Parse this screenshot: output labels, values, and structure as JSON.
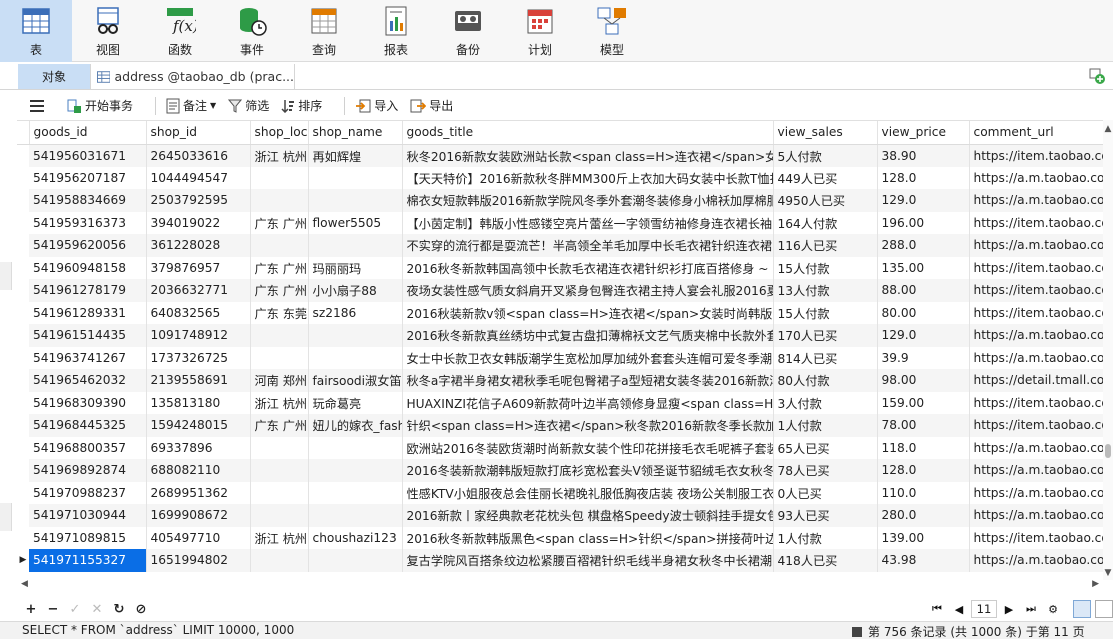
{
  "ribbon": {
    "items": [
      {
        "label": "表",
        "icon": "table-icon",
        "active": true
      },
      {
        "label": "视图",
        "icon": "view-icon",
        "active": false
      },
      {
        "label": "函数",
        "icon": "function-icon",
        "active": false
      },
      {
        "label": "事件",
        "icon": "event-icon",
        "active": false
      },
      {
        "label": "查询",
        "icon": "query-icon",
        "active": false
      },
      {
        "label": "报表",
        "icon": "report-icon",
        "active": false
      },
      {
        "label": "备份",
        "icon": "backup-icon",
        "active": false
      },
      {
        "label": "计划",
        "icon": "schedule-icon",
        "active": false
      },
      {
        "label": "模型",
        "icon": "model-icon",
        "active": false
      }
    ]
  },
  "tabs": {
    "object_label": "对象",
    "doc_label": "address @taobao_db (prac..."
  },
  "toolbar": {
    "begin_tx": "开始事务",
    "memo": "备注",
    "filter": "筛选",
    "sort": "排序",
    "import": "导入",
    "export": "导出"
  },
  "grid": {
    "columns": [
      "goods_id",
      "shop_id",
      "shop_loc",
      "shop_name",
      "goods_title",
      "view_sales",
      "view_price",
      "comment_url"
    ],
    "rows": [
      [
        "541956031671",
        "2645033616",
        "浙江 杭州",
        "再如辉煌",
        "秋冬2016新款女装欧洲站长款<span class=H>连衣裙</span>女装",
        "5人付款",
        "38.90",
        "https://item.taobao.co"
      ],
      [
        "541956207187",
        "1044494547",
        "",
        "",
        "【天天特价】2016新款秋冬胖MM300斤上衣加大码女装中长款T恤打底",
        "449人已买",
        "128.0",
        "https://a.m.taobao.co"
      ],
      [
        "541958834669",
        "2503792595",
        "",
        "",
        "棉衣女短款韩版2016新款学院风冬季外套潮冬装修身小棉袄加厚棉服",
        "4950人已买",
        "129.0",
        "https://a.m.taobao.co"
      ],
      [
        "541959316373",
        "394019022",
        "广东 广州",
        "flower5505",
        "【小茵定制】韩版小性感镂空亮片蕾丝一字领雪纺袖修身连衣裙长袖",
        "164人付款",
        "196.00",
        "https://item.taobao.co"
      ],
      [
        "541959620056",
        "361228028",
        "",
        "",
        "不实穿的流行都是耍流芒！半高领全羊毛加厚中长毛衣裙针织连衣裙",
        "116人已买",
        "288.0",
        "https://a.m.taobao.co"
      ],
      [
        "541960948158",
        "379876957",
        "广东 广州",
        "玛丽丽玛",
        "2016秋冬新款韩国高领中长款毛衣裙连衣裙针织衫打底百搭修身 ~",
        "15人付款",
        "135.00",
        "https://item.taobao.co"
      ],
      [
        "541961278179",
        "2036632771",
        "广东 广州",
        "小小扇子88",
        "夜场女装性感气质女斜肩开叉紧身包臀连衣裙主持人宴会礼服2016夏",
        "13人付款",
        "88.00",
        "https://item.taobao.co"
      ],
      [
        "541961289331",
        "640832565",
        "广东 东莞",
        "sz2186",
        "2016秋装新款v领<span class=H>连衣裙</span>女装时尚韩版<span",
        "15人付款",
        "80.00",
        "https://item.taobao.co"
      ],
      [
        "541961514435",
        "1091748912",
        "",
        "",
        "2016秋冬新款真丝绣坊中式复古盘扣薄棉袄文艺气质夹棉中长款外套",
        "170人已买",
        "129.0",
        "https://a.m.taobao.co"
      ],
      [
        "541963741267",
        "1737326725",
        "",
        "",
        "女士中长款卫衣女韩版潮学生宽松加厚加绒外套套头连帽可爱冬季潮",
        "814人已买",
        "39.9",
        "https://a.m.taobao.co"
      ],
      [
        "541965462032",
        "2139558691",
        "河南 郑州",
        "fairsoodi淑女笛",
        "秋冬a字裙半身裙女裙秋季毛呢包臀裙子a型短裙女装冬装2016新款潮",
        "80人付款",
        "98.00",
        "https://detail.tmall.co"
      ],
      [
        "541968309390",
        "135813180",
        "浙江 杭州",
        "玩命葛亮",
        "HUAXINZI花信子A609新款荷叶边半高领修身显瘦<span class=H>连",
        "3人付款",
        "159.00",
        "https://item.taobao.co"
      ],
      [
        "541968445325",
        "1594248015",
        "广东 广州",
        "妞儿的嫁衣_fash",
        "针织<span class=H>连衣裙</span>秋冬款2016新款冬季长款加厚",
        "1人付款",
        "78.00",
        "https://item.taobao.co"
      ],
      [
        "541968800357",
        "69337896",
        "",
        "",
        "欧洲站2016冬装欧货潮时尚新款女装个性印花拼接毛衣毛呢裤子套装",
        "65人已买",
        "118.0",
        "https://a.m.taobao.co"
      ],
      [
        "541969892874",
        "688082110",
        "",
        "",
        "2016冬装新款潮韩版短款打底衫宽松套头V领圣诞节貂绒毛衣女秋冬",
        "78人已买",
        "128.0",
        "https://a.m.taobao.co"
      ],
      [
        "541970988237",
        "2689951362",
        "",
        "",
        "性感KTV小姐服夜总会佳丽长裙晚礼服低胸夜店装 夜场公关制服工衣",
        "0人已买",
        "110.0",
        "https://a.m.taobao.co"
      ],
      [
        "541971030944",
        "1699908672",
        "",
        "",
        "2016新款丨家经典款老花枕头包 棋盘格Speedy波士顿斜挂手提女包",
        "93人已买",
        "280.0",
        "https://a.m.taobao.co"
      ],
      [
        "541971089815",
        "405497710",
        "浙江 杭州",
        "choushazi123",
        "2016秋冬新款韩版黑色<span class=H>针织</span>拼接荷叶边连衣",
        "1人付款",
        "139.00",
        "https://item.taobao.co"
      ],
      [
        "541971155327",
        "1651994802",
        "",
        "",
        "复古学院风百搭条纹边松紧腰百褶裙针织毛线半身裙女秋冬中长裙潮",
        "418人已买",
        "43.98",
        "https://a.m.taobao.co"
      ]
    ],
    "selected_row": 18
  },
  "pager": {
    "page": "11"
  },
  "status": {
    "sql": "SELECT * FROM `address` LIMIT 10000, 1000",
    "record_info": "第 756 条记录 (共 1000 条) 于第 11 页"
  },
  "colors": {
    "accent": "#c9def5",
    "selected": "#0a6ee6"
  }
}
